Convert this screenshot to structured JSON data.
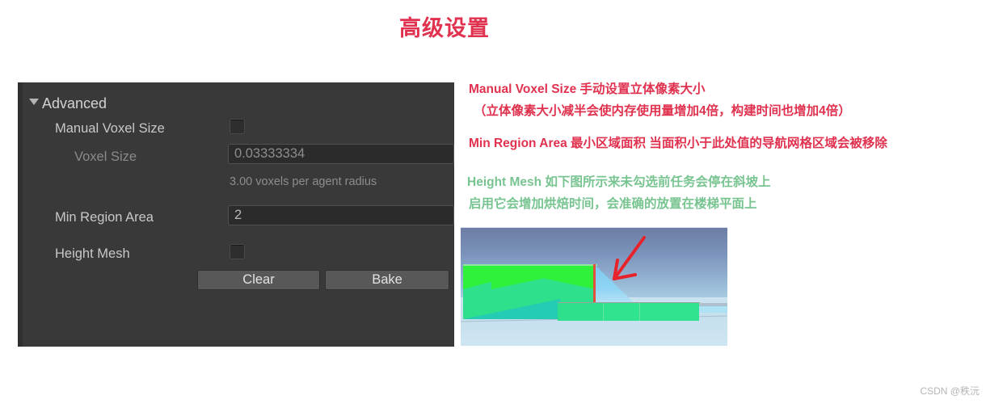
{
  "page": {
    "title": "高级设置",
    "title_color": "#e0324f",
    "watermark": "CSDN @秩沅"
  },
  "inspector": {
    "foldout_label": "Advanced",
    "rows": [
      {
        "label": "Manual Voxel Size",
        "control": "checkbox",
        "checked": false
      },
      {
        "label": "Voxel Size",
        "control": "textfield",
        "value": "0.03333334",
        "disabled": true
      },
      {
        "label": "Min Region Area",
        "control": "textfield",
        "value": "2",
        "disabled": false
      },
      {
        "label": "Height Mesh",
        "control": "checkbox",
        "checked": false
      }
    ],
    "voxel_hint": "3.00 voxels per agent radius",
    "buttons": {
      "clear_label": "Clear",
      "bake_label": "Bake"
    },
    "colors": {
      "panel_bg": "#393939",
      "field_bg": "#2b2b2b",
      "button_bg": "#585858",
      "label": "#c8c8c8",
      "label_disabled": "#8a8a8a"
    }
  },
  "annotations": {
    "manual_voxel_size": {
      "line1": "Manual Voxel Size 手动设置立体像素大小",
      "line2": "（立体像素大小减半会使内存使用量增加4倍，构建时间也增加4倍）",
      "color": "#e0324f"
    },
    "min_region_area": {
      "line1": "Min Region Area 最小区域面积 当面积小于此处值的导航网格区域会被移除",
      "color": "#e0324f"
    },
    "height_mesh": {
      "line1": "Height Mesh 如下图所示来未勾选前任务会停在斜坡上",
      "line2": "启用它会增加烘焙时间，会准确的放置在楼梯平面上",
      "color": "#78c491"
    }
  },
  "scene": {
    "caption": "navmesh-scene-screenshot",
    "arrow_color": "#e8222a",
    "navmesh_color": "#2fe08c",
    "ramp_color": "#8fd4f3"
  }
}
